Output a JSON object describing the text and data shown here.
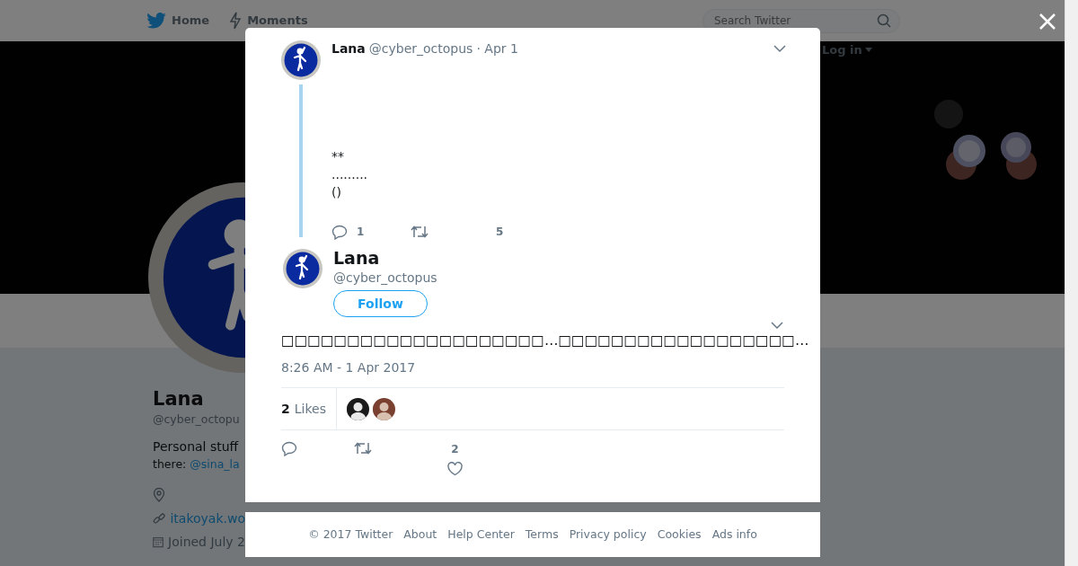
{
  "nav": {
    "items": [
      {
        "label": "Home"
      },
      {
        "label": "Moments"
      }
    ],
    "search": {
      "placeholder": "Search Twitter"
    },
    "login": "Log in"
  },
  "profile": {
    "name": "Lana",
    "handle": "@cyber_octopu",
    "bio": "Personal stuff",
    "bio_prefix": "there:",
    "bio_link": "@sina_la",
    "website": "itakoyak.wo",
    "joined": "Joined July 2"
  },
  "parent_tweet": {
    "name": "Lana",
    "handle": "@cyber_octopus",
    "time": "· Apr 1",
    "lines": [
      "**",
      ".........",
      "()"
    ],
    "replies": "1",
    "likes": "5"
  },
  "tweet": {
    "name": "Lana",
    "handle": "@cyber_octopus",
    "follow": "Follow",
    "text": "□□□□□□□□□□□□□□□□□□□□…□□□□□□□□□□□□□□□□□□…",
    "timestamp": "8:26 AM - 1 Apr 2017",
    "likes_count": "2",
    "likes_label": "Likes",
    "like_action_count": "2"
  },
  "footer": [
    "© 2017 Twitter",
    "About",
    "Help Center",
    "Terms",
    "Privacy policy",
    "Cookies",
    "Ads info"
  ]
}
